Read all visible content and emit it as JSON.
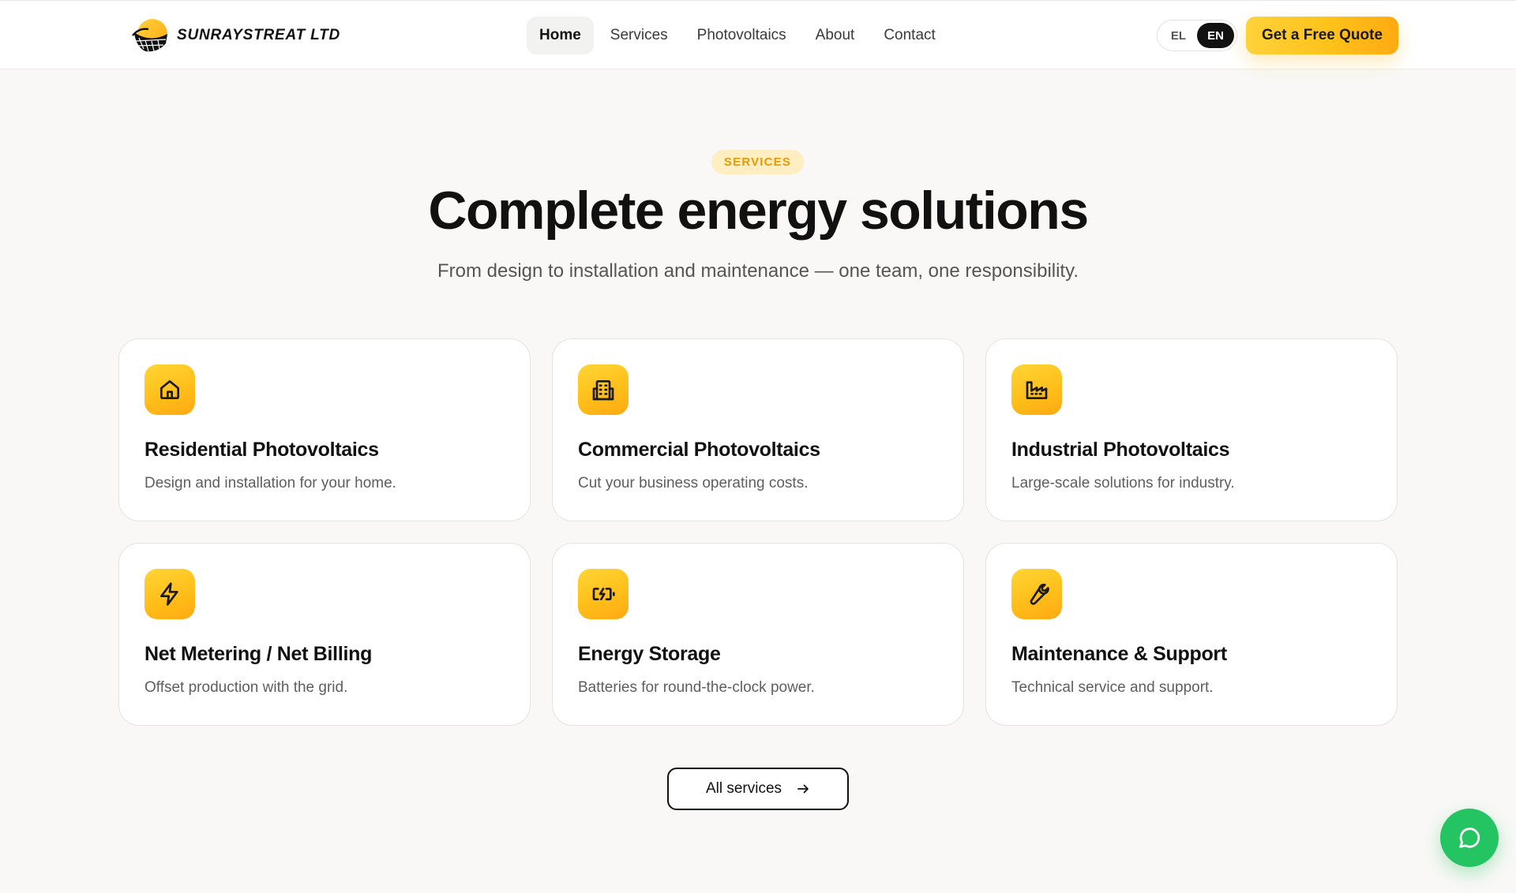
{
  "header": {
    "logo_text": "SUNRAYSTREAT LTD",
    "nav": [
      {
        "label": "Home",
        "active": true
      },
      {
        "label": "Services"
      },
      {
        "label": "Photovoltaics"
      },
      {
        "label": "About"
      },
      {
        "label": "Contact"
      }
    ],
    "lang": {
      "options": [
        "EL",
        "EN"
      ],
      "selected": "EN"
    },
    "cta_label": "Get a Free Quote"
  },
  "section": {
    "badge": "SERVICES",
    "title": "Complete energy solutions",
    "subtitle": "From design to installation and maintenance — one team, one responsibility."
  },
  "services": [
    {
      "title": "Residential Photovoltaics",
      "desc": "Design and installation for your home.",
      "icon": "home-icon"
    },
    {
      "title": "Commercial Photovoltaics",
      "desc": "Cut your business operating costs.",
      "icon": "building-icon"
    },
    {
      "title": "Industrial Photovoltaics",
      "desc": "Large-scale solutions for industry.",
      "icon": "factory-icon"
    },
    {
      "title": "Net Metering / Net Billing",
      "desc": "Offset production with the grid.",
      "icon": "lightning-icon"
    },
    {
      "title": "Energy Storage",
      "desc": "Batteries for round-the-clock power.",
      "icon": "battery-charging-icon"
    },
    {
      "title": "Maintenance & Support",
      "desc": "Technical service and support.",
      "icon": "wrench-icon"
    }
  ],
  "all_services_label": "All services",
  "colors": {
    "accent": "#ffc21a",
    "badge_bg": "#ffeec2",
    "badge_text": "#e59a00",
    "chat": "#25c462"
  }
}
